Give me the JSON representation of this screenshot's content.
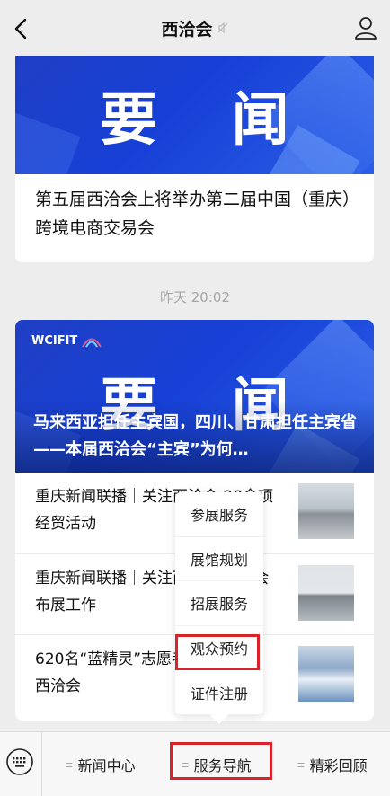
{
  "header": {
    "title": "西洽会",
    "back_icon": "chevron-left-icon",
    "profile_icon": "user-icon",
    "mute_icon": "mute-icon"
  },
  "card1": {
    "banner_text": "要 闻",
    "headline": "第五届西洽会上将举办第二届中国（重庆）跨境电商交易会"
  },
  "timestamp": "昨天 20:02",
  "card2": {
    "logo_text": "WCIFIT",
    "banner_text": "要 闻",
    "lead": "马来西亚担任主宾国，四川、甘肃担任主宾省——本届西洽会“主宾”为何…",
    "items": [
      {
        "text": "重庆新闻联播｜关注西洽会·20余项经贸活动"
      },
      {
        "text": "重庆新闻联播｜关注西洽会·西洽会布展工作"
      },
      {
        "text": "620名“蓝精灵”志愿者服务第五届西洽会"
      }
    ]
  },
  "popup_menu": {
    "items": [
      "参展服务",
      "展馆规划",
      "招展服务",
      "观众预约",
      "证件注册"
    ],
    "highlighted": "观众预约"
  },
  "bottom_menu": {
    "keyboard_icon": "keyboard-icon",
    "tabs": [
      "新闻中心",
      "服务导航",
      "精彩回顾"
    ],
    "highlighted": "服务导航"
  },
  "colors": {
    "banner_blue": "#1740d6",
    "highlight_red": "#d9222a"
  }
}
